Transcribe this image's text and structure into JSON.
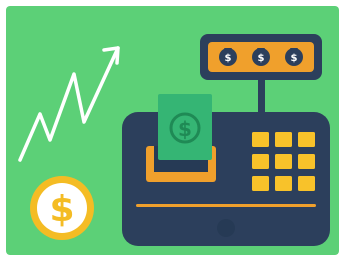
{
  "illustration": {
    "subject": "cash-register",
    "colors": {
      "background_green": "#5cd077",
      "register_body": "#2c3f5c",
      "register_base": "#263a55",
      "display_panel": "#f0a02c",
      "display_bezel": "#2c3f5c",
      "keypad_key": "#f8c22a",
      "cash_drawer": "#f0a02c",
      "banknote": "#35b574",
      "banknote_symbol": "#1f8a55",
      "coin_outer": "#f4bc24",
      "coin_inner": "#ffffff",
      "coin_symbol": "#f4bc24",
      "trend_line": "#ffffff"
    },
    "display_icons": [
      "money-bag-icon",
      "money-bag-icon",
      "money-bag-icon"
    ],
    "banknote_symbol": "$",
    "coin_symbol": "$"
  }
}
